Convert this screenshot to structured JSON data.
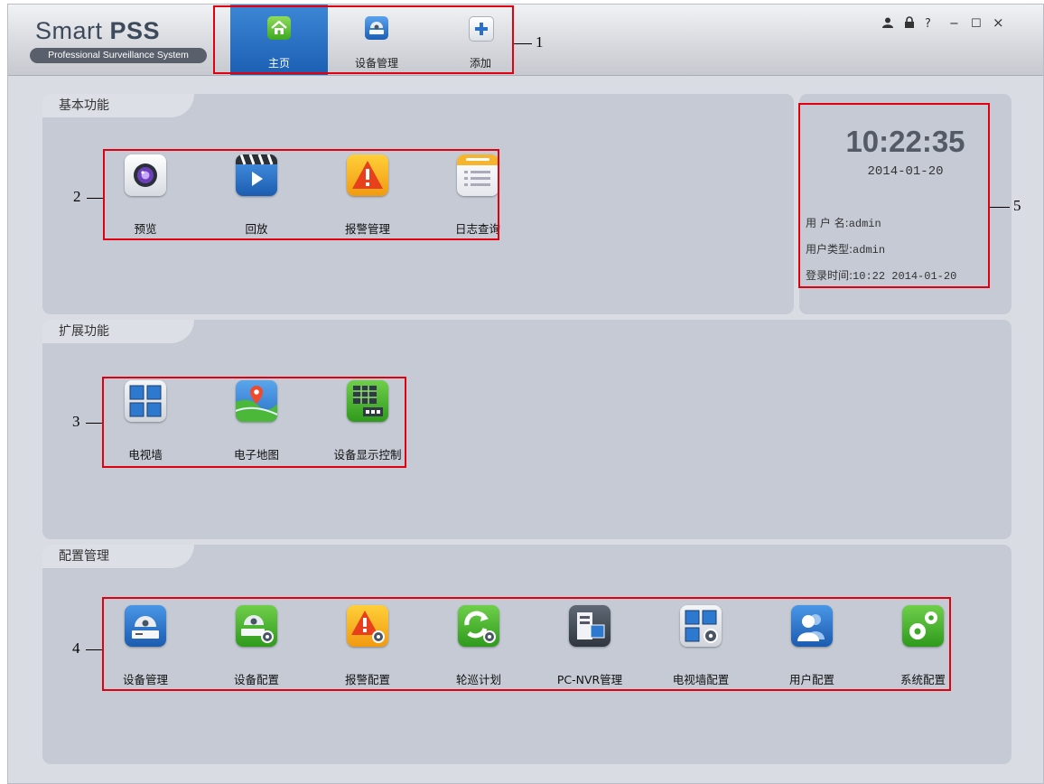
{
  "app": {
    "title_regular": "Smart ",
    "title_bold": "PSS",
    "subtitle": "Professional Surveillance System"
  },
  "nav": [
    {
      "label": "主页",
      "icon": "home-icon",
      "active": true
    },
    {
      "label": "设备管理",
      "icon": "device-camera-icon",
      "active": false
    },
    {
      "label": "添加",
      "icon": "plus-icon",
      "active": false
    }
  ],
  "window_controls": {
    "user": "user-icon",
    "lock": "lock-icon",
    "help": "?",
    "minimize": "−",
    "maximize": "☐",
    "close": "×"
  },
  "callouts": [
    "1",
    "2",
    "3",
    "4",
    "5"
  ],
  "sections": {
    "basic": {
      "title": "基本功能",
      "items": [
        {
          "label": "预览",
          "icon": "preview-camera-icon"
        },
        {
          "label": "回放",
          "icon": "playback-icon"
        },
        {
          "label": "报警管理",
          "icon": "alarm-icon"
        },
        {
          "label": "日志查询",
          "icon": "log-icon"
        }
      ]
    },
    "extended": {
      "title": "扩展功能",
      "items": [
        {
          "label": "电视墙",
          "icon": "tv-wall-icon"
        },
        {
          "label": "电子地图",
          "icon": "e-map-icon"
        },
        {
          "label": "设备显示控制",
          "icon": "device-display-icon"
        }
      ]
    },
    "config": {
      "title": "配置管理",
      "items": [
        {
          "label": "设备管理",
          "icon": "device-manager-icon"
        },
        {
          "label": "设备配置",
          "icon": "device-config-icon"
        },
        {
          "label": "报警配置",
          "icon": "alarm-config-icon"
        },
        {
          "label": "轮巡计划",
          "icon": "tour-plan-icon"
        },
        {
          "label": "PC-NVR管理",
          "icon": "pc-nvr-icon"
        },
        {
          "label": "电视墙配置",
          "icon": "tv-wall-config-icon"
        },
        {
          "label": "用户配置",
          "icon": "user-config-icon"
        },
        {
          "label": "系统配置",
          "icon": "system-config-icon"
        }
      ]
    }
  },
  "status": {
    "time": "10:22:35",
    "date": "2014-01-20",
    "username_label": "用 户 名:",
    "username": "admin",
    "usertype_label": "用户类型:",
    "usertype": "admin",
    "login_label": "登录时间:",
    "login_time": "10:22 2014-01-20"
  },
  "colors": {
    "accent": "#1f67bf",
    "callout": "#e0000f",
    "panel": "#c5cad4"
  }
}
